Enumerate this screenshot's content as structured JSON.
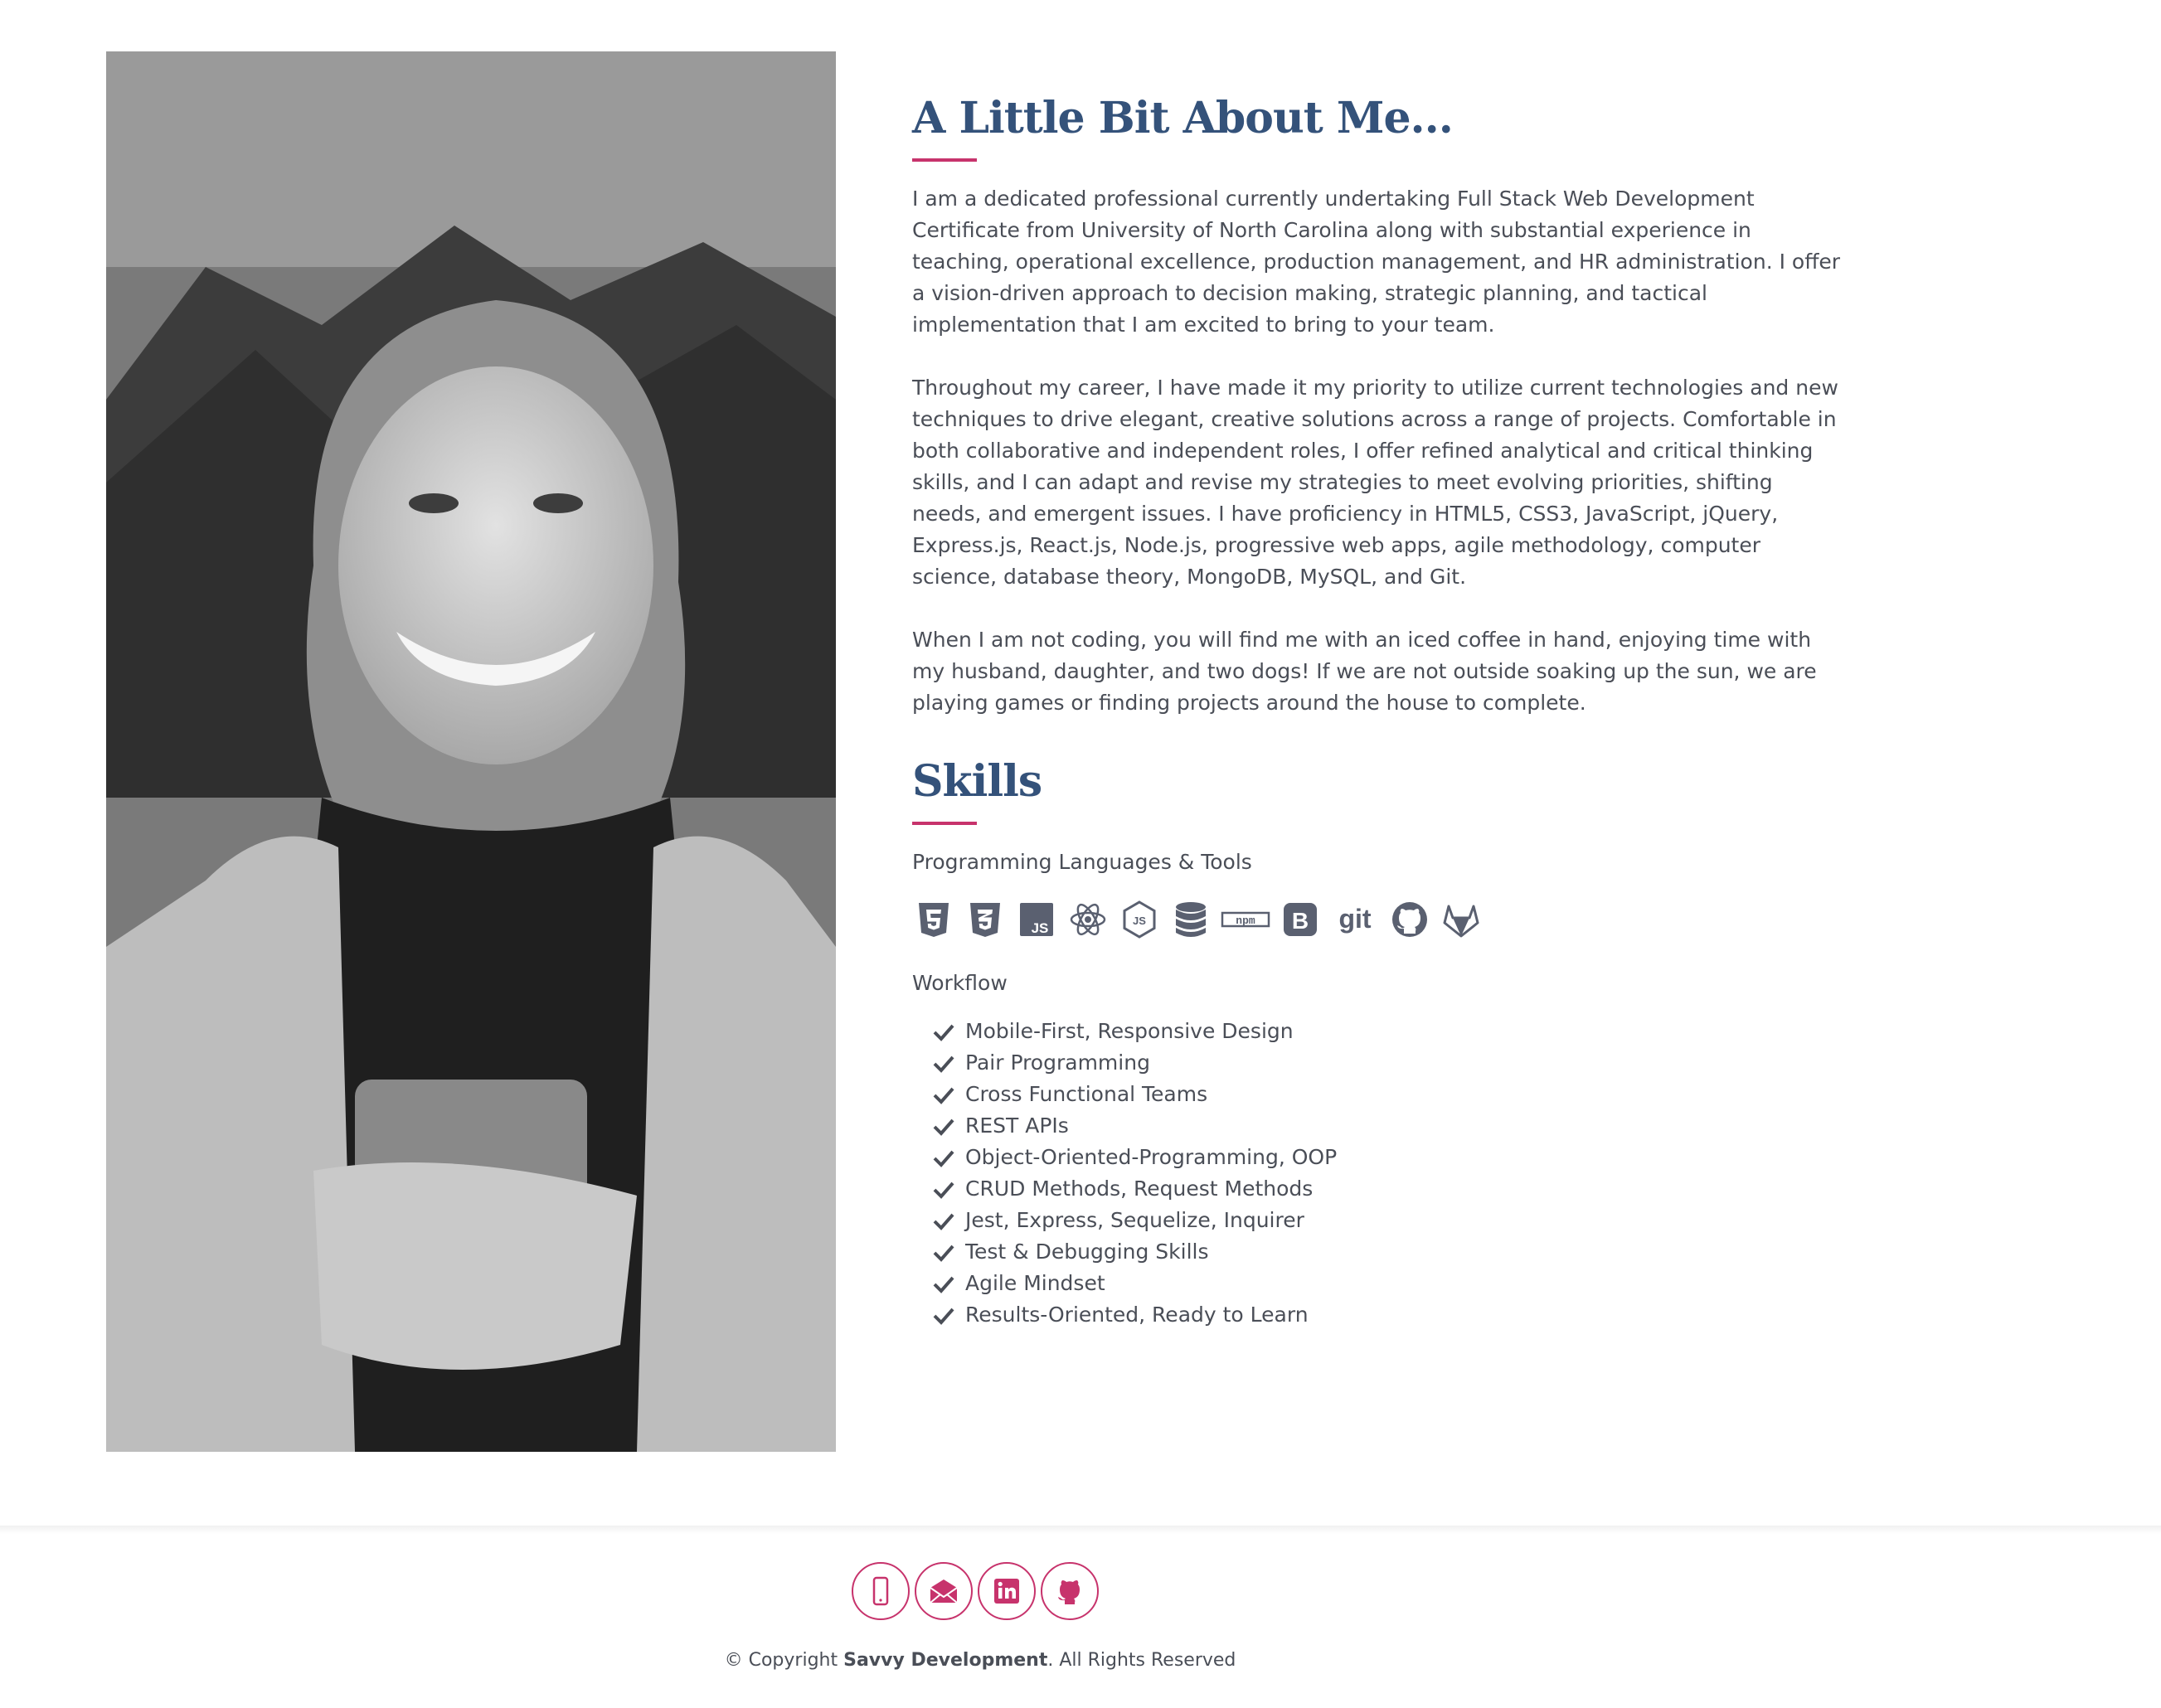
{
  "about": {
    "heading": "A Little Bit About Me...",
    "paragraphs": [
      "I am a dedicated professional currently undertaking Full Stack Web Development Certificate from University of North Carolina along with substantial experience in teaching, operational excellence, production management, and HR administration. I offer a vision-driven approach to decision making, strategic planning, and tactical implementation that I am excited to bring to your team.",
      "Throughout my career, I have made it my priority to utilize current technologies and new techniques to drive elegant, creative solutions across a range of projects. Comfortable in both collaborative and independent roles, I offer refined analytical and critical thinking skills, and I can adapt and revise my strategies to meet evolving priorities, shifting needs, and emergent issues. I have proficiency in HTML5, CSS3, JavaScript, jQuery, Express.js, React.js, Node.js, progressive web apps, agile methodology, computer science, database theory, MongoDB, MySQL, and Git.",
      "When I am not coding, you will find me with an iced coffee in hand, enjoying time with my husband, daughter, and two dogs! If we are not outside soaking up the sun, we are playing games or finding projects around the house to complete."
    ]
  },
  "skills": {
    "heading": "Skills",
    "tools_label": "Programming Languages & Tools",
    "tool_icons": [
      "html5-icon",
      "css3-icon",
      "javascript-icon",
      "react-icon",
      "nodejs-icon",
      "database-icon",
      "npm-icon",
      "bootstrap-icon",
      "git-icon",
      "github-icon",
      "gitlab-icon"
    ],
    "git_text": "git",
    "npm_text": "npm",
    "js_text": "JS",
    "bootstrap_text": "B",
    "workflow_label": "Workflow",
    "workflow": [
      "Mobile-First, Responsive Design",
      "Pair Programming",
      "Cross Functional Teams",
      "REST APIs",
      "Object-Oriented-Programming, OOP",
      "CRUD Methods, Request Methods",
      "Jest, Express, Sequelize, Inquirer",
      "Test & Debugging Skills",
      "Agile Mindset",
      "Results-Oriented, Ready to Learn"
    ]
  },
  "footer": {
    "social": [
      "phone-icon",
      "email-icon",
      "linkedin-icon",
      "github-icon"
    ],
    "copyright_prefix": "© Copyright ",
    "company": "Savvy Development",
    "copyright_suffix": ". All Rights Reserved"
  },
  "colors": {
    "heading": "#34527a",
    "accent": "#c7336c",
    "text": "#4a4e57",
    "icon": "#5a6070"
  }
}
